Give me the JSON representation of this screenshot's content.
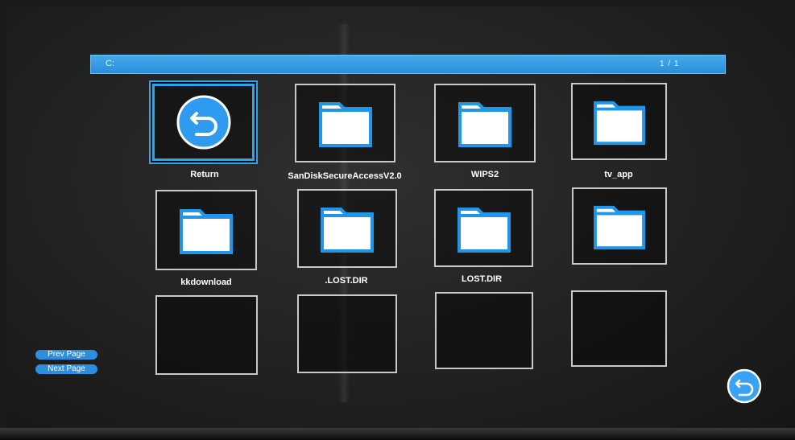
{
  "path_bar": {
    "path": "C:",
    "page_indicator": "1 / 1"
  },
  "grid": {
    "items": [
      {
        "label": "Return",
        "icon": "return-icon",
        "selected": true
      },
      {
        "label": "SanDiskSecureAccessV2.0",
        "icon": "folder-icon"
      },
      {
        "label": "WIPS2",
        "icon": "folder-icon"
      },
      {
        "label": "tv_app",
        "icon": "folder-icon"
      },
      {
        "label": "kkdownload",
        "icon": "folder-icon"
      },
      {
        "label": ".LOST.DIR",
        "icon": "folder-icon"
      },
      {
        "label": "LOST.DIR",
        "icon": "folder-icon"
      },
      {
        "label": "",
        "icon": "folder-icon"
      },
      {
        "label": "",
        "icon": ""
      },
      {
        "label": "",
        "icon": ""
      },
      {
        "label": "",
        "icon": ""
      },
      {
        "label": "",
        "icon": ""
      }
    ]
  },
  "nav": {
    "prev_page": "Prev Page",
    "next_page": "Next Page"
  },
  "colors": {
    "accent": "#2a8fd8",
    "tile_border": "#c9c9c9",
    "folder_blue": "#2196e8"
  }
}
